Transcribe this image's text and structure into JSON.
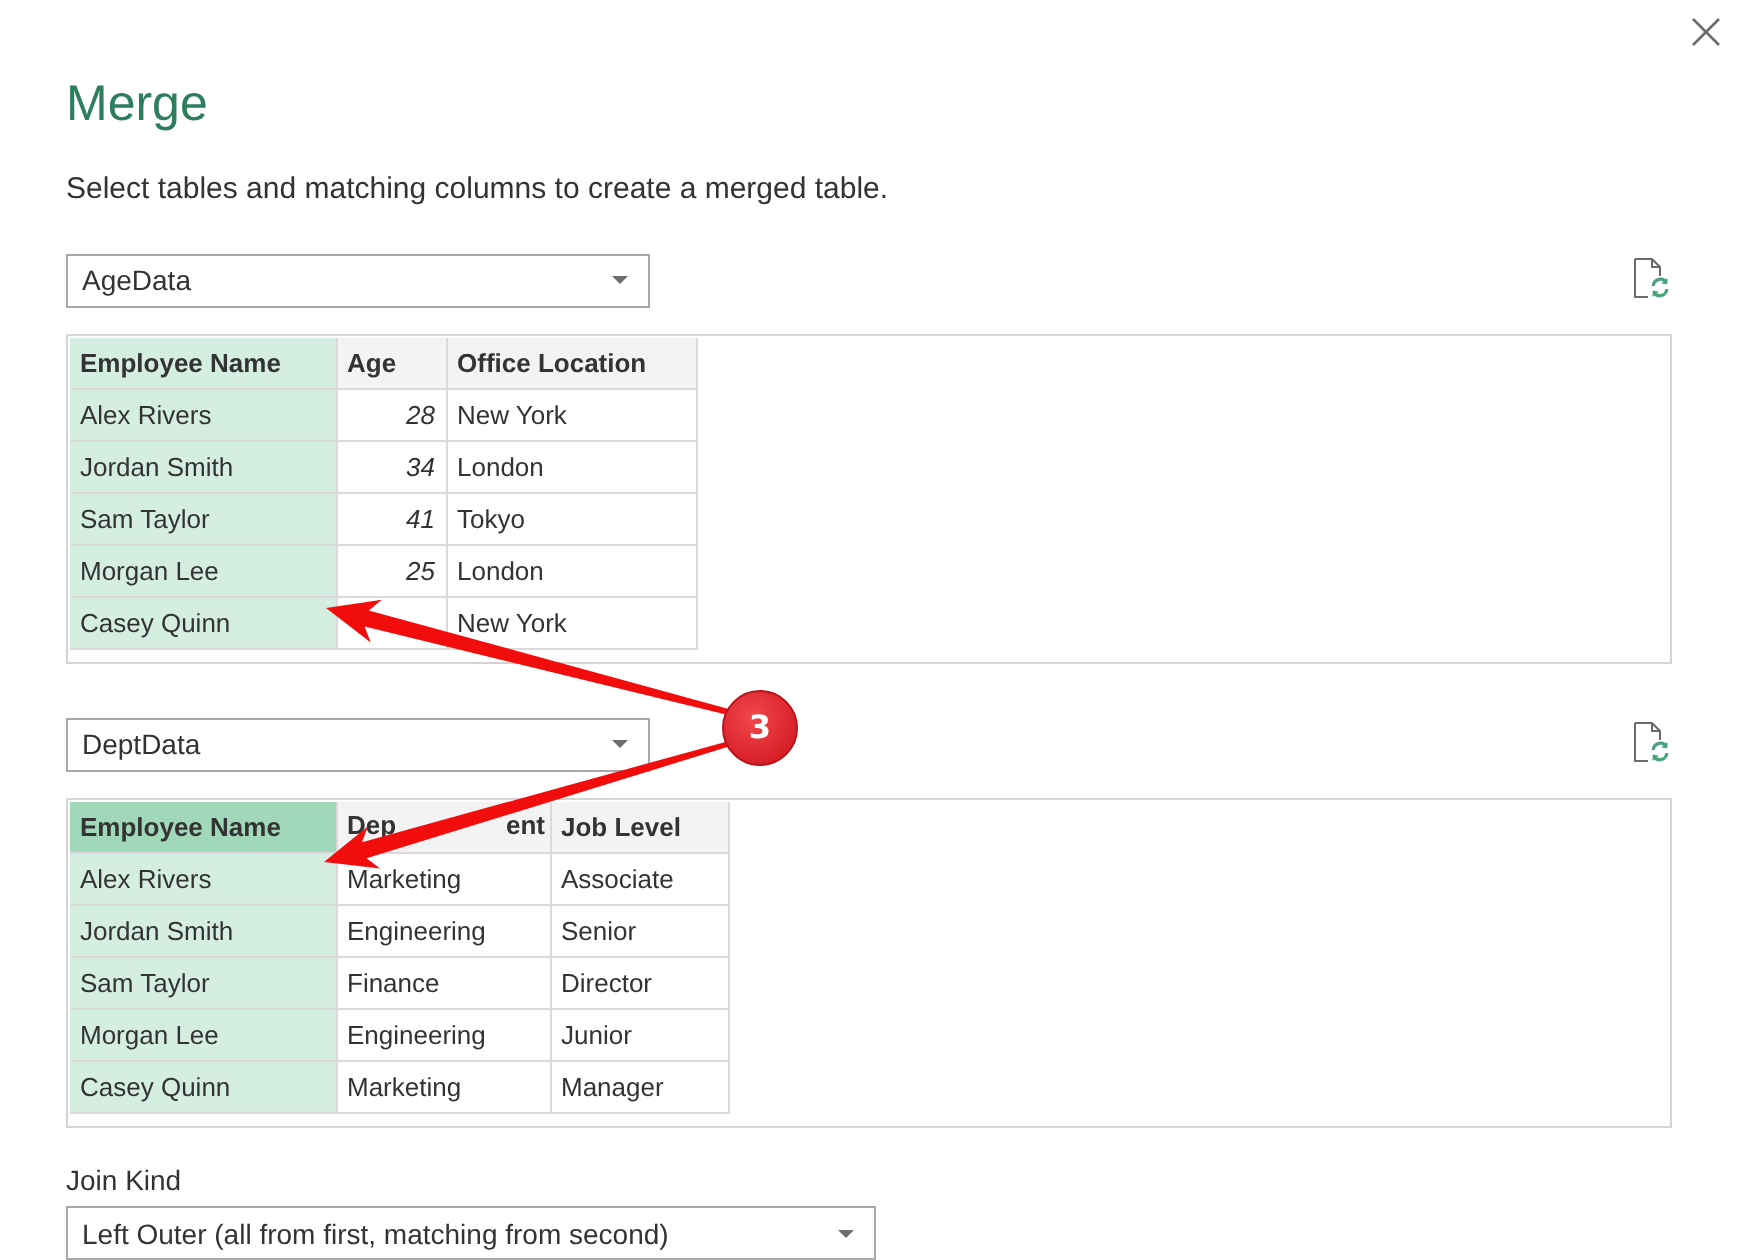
{
  "dialog": {
    "title": "Merge",
    "description": "Select tables and matching columns to create a merged table."
  },
  "tables": [
    {
      "source": "AgeData",
      "focused": false,
      "columns": [
        {
          "label": "Employee Name",
          "kind": "text",
          "selected": true
        },
        {
          "label": "Age",
          "kind": "number",
          "selected": false
        },
        {
          "label": "Office Location",
          "kind": "text",
          "selected": false
        }
      ],
      "rows": [
        [
          "Alex Rivers",
          "28",
          "New York"
        ],
        [
          "Jordan Smith",
          "34",
          "London"
        ],
        [
          "Sam Taylor",
          "41",
          "Tokyo"
        ],
        [
          "Morgan Lee",
          "25",
          "London"
        ],
        [
          "Casey Quinn",
          null,
          "New York"
        ]
      ]
    },
    {
      "source": "DeptData",
      "focused": true,
      "columns": [
        {
          "label": "Employee Name",
          "kind": "text",
          "selected": true
        },
        {
          "label_parts": [
            "Dep",
            "ent"
          ],
          "kind": "text",
          "selected": false
        },
        {
          "label": "Job Level",
          "kind": "text",
          "selected": false
        }
      ],
      "rows": [
        [
          "Alex Rivers",
          "Marketing",
          "Associate"
        ],
        [
          "Jordan Smith",
          "Engineering",
          "Senior"
        ],
        [
          "Sam Taylor",
          "Finance",
          "Director"
        ],
        [
          "Morgan Lee",
          "Engineering",
          "Junior"
        ],
        [
          "Casey Quinn",
          "Marketing",
          "Manager"
        ]
      ]
    }
  ],
  "join_kind": {
    "label": "Join Kind",
    "value": "Left Outer (all from first, matching from second)"
  },
  "annotation": {
    "badge": "3"
  }
}
